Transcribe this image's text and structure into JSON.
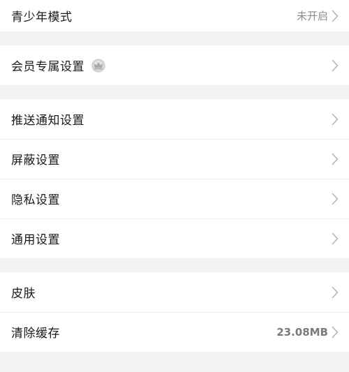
{
  "settings": {
    "youth_mode": {
      "label": "青少年模式",
      "value": "未开启"
    },
    "member": {
      "label": "会员专属设置",
      "badge_icon": "crown-icon"
    },
    "push": {
      "label": "推送通知设置"
    },
    "block": {
      "label": "屏蔽设置"
    },
    "privacy": {
      "label": "隐私设置"
    },
    "general": {
      "label": "通用设置"
    },
    "skin": {
      "label": "皮肤"
    },
    "cache": {
      "label": "清除缓存",
      "value": "23.08MB"
    }
  },
  "icons": {
    "chevron": "chevron-right-icon"
  },
  "colors": {
    "background": "#f2f2f2",
    "row": "#ffffff",
    "text": "#1a1a1a",
    "secondary": "#8a8a8a",
    "chevron": "#b3b3b3"
  }
}
